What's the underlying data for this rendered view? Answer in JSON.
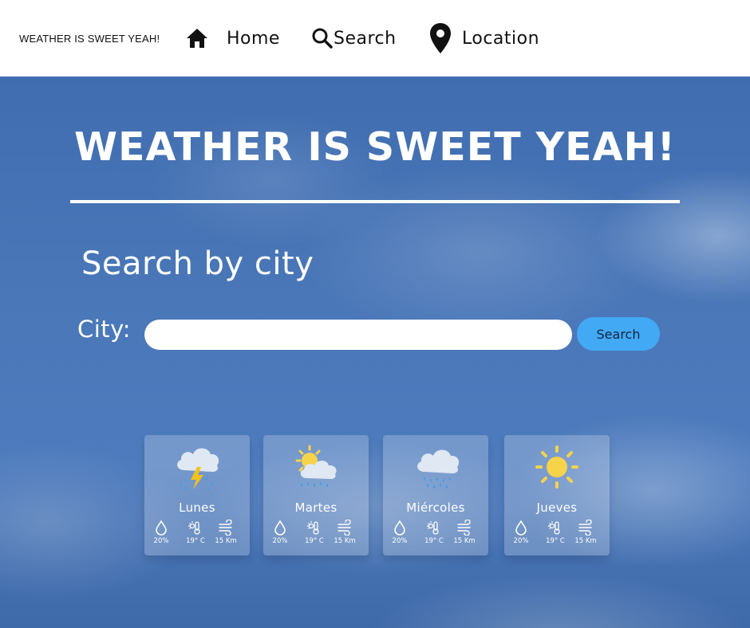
{
  "brand": "WEATHER IS SWEET YEAH!",
  "nav": {
    "home": {
      "label": "Home",
      "icon": "home-icon"
    },
    "search": {
      "label": "Search",
      "icon": "search-icon"
    },
    "location": {
      "label": "Location",
      "icon": "location-pin-icon"
    }
  },
  "hero": {
    "title": "WEATHER IS SWEET YEAH!",
    "search_heading": "Search by city",
    "city_label": "City:",
    "city_input": {
      "value": "",
      "placeholder": ""
    },
    "search_button": "Search"
  },
  "forecast": [
    {
      "day": "Lunes",
      "icon": "thunderstorm-icon",
      "humidity": "20%",
      "temperature": "19° C",
      "wind": "15 Km"
    },
    {
      "day": "Martes",
      "icon": "partly-cloudy-rain-icon",
      "humidity": "20%",
      "temperature": "19° C",
      "wind": "15 Km"
    },
    {
      "day": "Miércoles",
      "icon": "rain-icon",
      "humidity": "20%",
      "temperature": "19° C",
      "wind": "15 Km"
    },
    {
      "day": "Jueves",
      "icon": "sun-icon",
      "humidity": "20%",
      "temperature": "19° C",
      "wind": "15 Km"
    }
  ],
  "colors": {
    "sky": "#4a77b8",
    "search_button": "#42a9f5",
    "sun": "#f7d34a",
    "rain": "#3aa0ea"
  }
}
